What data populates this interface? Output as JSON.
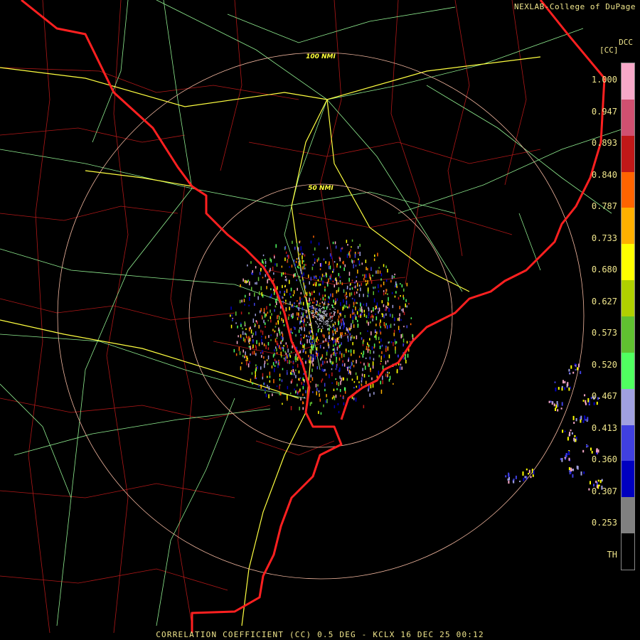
{
  "credit": "NEXLAB-College of DuPage",
  "legend": {
    "product_code": "DCC",
    "units": "[CC]",
    "tick_labels": [
      "1.000",
      "0.947",
      "0.893",
      "0.840",
      "0.787",
      "0.733",
      "0.680",
      "0.627",
      "0.573",
      "0.520",
      "0.467",
      "0.413",
      "0.360",
      "0.307",
      "0.253",
      "TH"
    ],
    "colors": [
      "#f7a8c8",
      "#d05070",
      "#c01818",
      "#ff6400",
      "#ffb000",
      "#ffff00",
      "#b0d000",
      "#60c030",
      "#50ff60",
      "#a0a0e0",
      "#4040e0",
      "#0000c0",
      "#808080",
      "#000000"
    ]
  },
  "range_rings": {
    "inner": "50 NMI",
    "outer": "100 NMI"
  },
  "footer": "CORRELATION COEFFICIENT (CC) 0.5 DEG - KCLX 16 DEC 25 00:12",
  "map_colors": {
    "state_border": "#ff2020",
    "county_lines": "#b01818",
    "highways": "#ffff40",
    "roads": "#90ee90",
    "range_ring": "#f4b8a0"
  }
}
